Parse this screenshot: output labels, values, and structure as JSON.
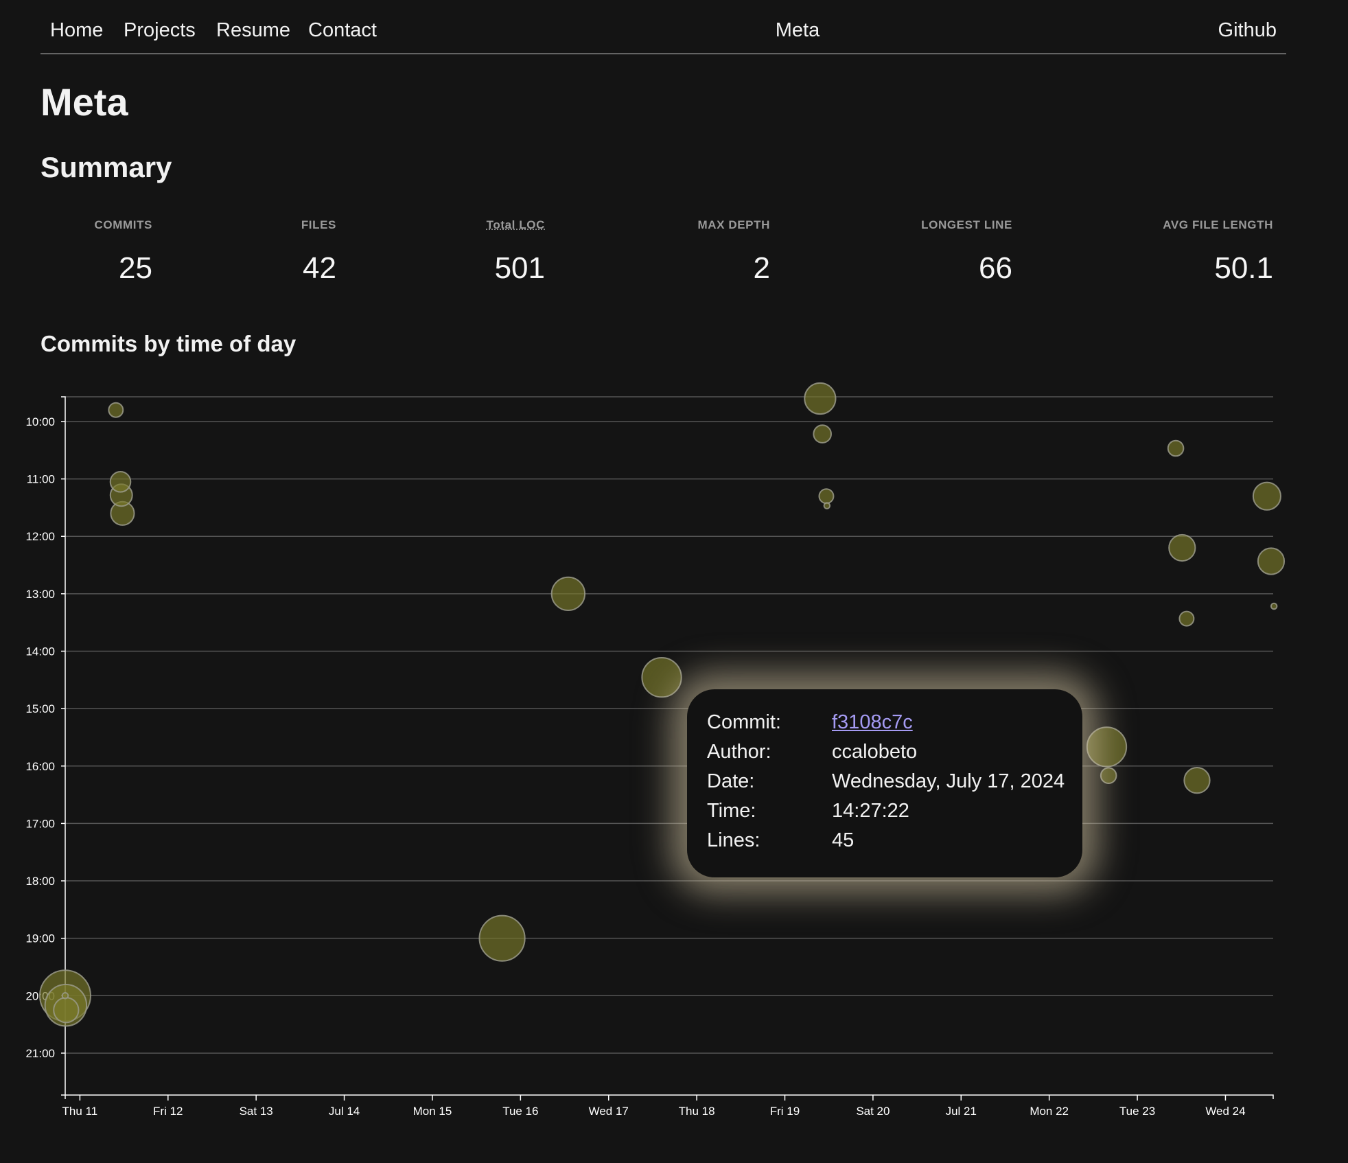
{
  "nav": {
    "left_links": [
      "Home",
      "Projects",
      "Resume",
      "Contact"
    ],
    "center": "Meta",
    "right": "Github"
  },
  "page_title": "Meta",
  "summary": {
    "title": "Summary",
    "stats": [
      {
        "label": "COMMITS",
        "value": "25"
      },
      {
        "label": "FILES",
        "value": "42"
      },
      {
        "label": "Total LOC",
        "value": "501"
      },
      {
        "label": "MAX DEPTH",
        "value": "2"
      },
      {
        "label": "LONGEST LINE",
        "value": "66"
      },
      {
        "label": "AVG FILE LENGTH",
        "value": "50.1"
      }
    ]
  },
  "chart_title": "Commits by time of day",
  "colors": {
    "background": "#141414",
    "bubble_fill": "#7a7a2a",
    "bubble_stroke": "#9a9a8a",
    "grid": "#555555",
    "tooltip_glow": "#dccdaa",
    "link": "#a59bf3"
  },
  "chart_data": {
    "type": "scatter",
    "title": "Commits by time of day",
    "xlabel": "",
    "ylabel": "",
    "x_ticks": [
      "Thu 11",
      "Fri 12",
      "Sat 13",
      "Jul 14",
      "Mon 15",
      "Tue 16",
      "Wed 17",
      "Thu 18",
      "Fri 19",
      "Sat 20",
      "Jul 21",
      "Mon 22",
      "Tue 23",
      "Wed 24"
    ],
    "y_ticks": [
      "10:00",
      "11:00",
      "12:00",
      "13:00",
      "14:00",
      "15:00",
      "16:00",
      "17:00",
      "18:00",
      "19:00",
      "20:00",
      "21:00"
    ],
    "x_domain": [
      "2024-07-10 20:00",
      "2024-07-24 13:00"
    ],
    "y_domain_hours": [
      9.57,
      21.73
    ],
    "size_encoding": "lines changed",
    "grid": true,
    "points": [
      {
        "datetime": "2024-07-11 09:48",
        "lines": 6
      },
      {
        "datetime": "2024-07-11 11:03",
        "lines": 12
      },
      {
        "datetime": "2024-07-11 11:17",
        "lines": 14
      },
      {
        "datetime": "2024-07-11 11:36",
        "lines": 16
      },
      {
        "datetime": "2024-07-10 20:00",
        "lines": 75
      },
      {
        "datetime": "2024-07-10 20:10",
        "lines": 50
      },
      {
        "datetime": "2024-07-10 20:15",
        "lines": 18
      },
      {
        "datetime": "2024-07-10 20:00",
        "lines": 1
      },
      {
        "datetime": "2024-07-15 19:00",
        "lines": 60
      },
      {
        "datetime": "2024-07-16 13:00",
        "lines": 32
      },
      {
        "datetime": "2024-07-17 14:27:22",
        "lines": 45,
        "commit": "f3108c7c",
        "author": "ccalobeto"
      },
      {
        "datetime": "2024-07-19 09:36",
        "lines": 28
      },
      {
        "datetime": "2024-07-19 10:13",
        "lines": 9
      },
      {
        "datetime": "2024-07-19 11:18",
        "lines": 6
      },
      {
        "datetime": "2024-07-19 11:28",
        "lines": 1
      },
      {
        "datetime": "2024-07-22 15:40",
        "lines": 45
      },
      {
        "datetime": "2024-07-22 16:10",
        "lines": 7
      },
      {
        "datetime": "2024-07-23 10:28",
        "lines": 7
      },
      {
        "datetime": "2024-07-23 12:12",
        "lines": 20
      },
      {
        "datetime": "2024-07-23 13:26",
        "lines": 6
      },
      {
        "datetime": "2024-07-23 16:15",
        "lines": 19
      },
      {
        "datetime": "2024-07-24 11:18",
        "lines": 22
      },
      {
        "datetime": "2024-07-24 12:26",
        "lines": 20
      },
      {
        "datetime": "2024-07-24 13:13",
        "lines": 1
      }
    ]
  },
  "tooltip": {
    "rows": [
      {
        "key": "Commit:",
        "value": "f3108c7c",
        "link": true
      },
      {
        "key": "Author:",
        "value": "ccalobeto"
      },
      {
        "key": "Date:",
        "value": "Wednesday, July 17, 2024"
      },
      {
        "key": "Time:",
        "value": "14:27:22"
      },
      {
        "key": "Lines:",
        "value": "45"
      }
    ]
  }
}
